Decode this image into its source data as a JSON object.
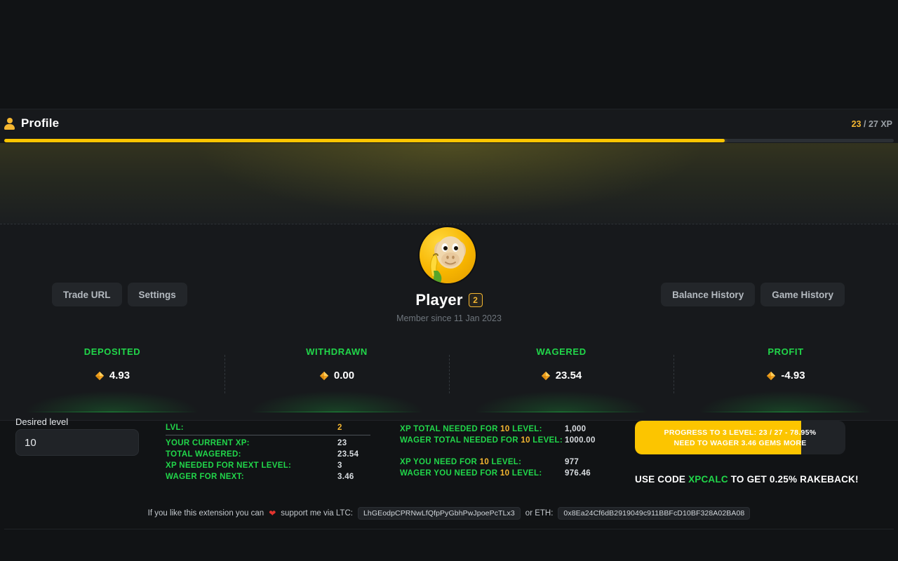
{
  "header": {
    "title": "Profile",
    "person_icon": "person-icon",
    "xp_current": "23",
    "xp_separator": " / ",
    "xp_total": "27 XP",
    "xp_percent": 81
  },
  "profile": {
    "avatar_icon": "monkey-avatar",
    "player_name": "Player",
    "level_badge": "2",
    "member_since": "Member since 11 Jan 2023",
    "left_buttons": [
      {
        "label": "Trade URL",
        "name": "trade-url-button"
      },
      {
        "label": "Settings",
        "name": "settings-button"
      }
    ],
    "right_buttons": [
      {
        "label": "Balance History",
        "name": "balance-history-button"
      },
      {
        "label": "Game History",
        "name": "game-history-button"
      }
    ]
  },
  "stats": [
    {
      "label": "DEPOSITED",
      "value": "4.93",
      "icon": "gem-icon"
    },
    {
      "label": "WITHDRAWN",
      "value": "0.00",
      "icon": "gem-icon"
    },
    {
      "label": "WAGERED",
      "value": "23.54",
      "icon": "gem-icon"
    },
    {
      "label": "PROFIT",
      "value": "-4.93",
      "icon": "gem-icon"
    }
  ],
  "calculator": {
    "desired_level_label": "Desired level",
    "desired_level_value": "10",
    "desired_level_placeholder": "Level",
    "left_column": [
      {
        "key": "LVL:",
        "value": "2"
      },
      {
        "key": "YOUR CURRENT XP:",
        "value": "23"
      },
      {
        "key": "TOTAL WAGERED:",
        "value": "23.54"
      },
      {
        "key": "XP NEEDED FOR NEXT LEVEL:",
        "value": "3"
      },
      {
        "key": "WAGER FOR NEXT:",
        "value": "3.46"
      }
    ],
    "mid_column": [
      {
        "pre": "XP TOTAL NEEDED FOR ",
        "hl": "10",
        "post": " LEVEL:",
        "value": "1,000"
      },
      {
        "pre": "WAGER TOTAL NEEDED FOR ",
        "hl": "10",
        "post": " LEVEL:",
        "value": "1000.00"
      },
      {
        "pre": "XP YOU NEED FOR ",
        "hl": "10",
        "post": " LEVEL:",
        "value": "977"
      },
      {
        "pre": "WAGER YOU NEED FOR ",
        "hl": "10",
        "post": " LEVEL:",
        "value": "976.46"
      }
    ],
    "progress": {
      "line1": "PROGRESS TO 3 LEVEL: 23 / 27 - 78.95%",
      "line2": "NEED TO WAGER 3.46 GEMS MORE",
      "percent": 78.95
    },
    "rakeback_pre": "USE CODE ",
    "rakeback_code": "XPCALC",
    "rakeback_post": " TO GET 0.25% RAKEBACK!"
  },
  "footer": {
    "text_before": "If you like this extension you can",
    "heart_icon": "heart-icon",
    "text_after": "support me via LTC:",
    "ltc_address": "LhGEodpCPRNwLfQfpPyGbhPwJpoePcTLx3",
    "eth_label": "or ETH:",
    "eth_address": "0x8Ea24Cf6dB2919049c911BBFcD10BF328A02BA08"
  },
  "colors": {
    "accent_gold": "#fcc500",
    "accent_green": "#21d64a",
    "background": "#111315",
    "card": "#17191c"
  }
}
